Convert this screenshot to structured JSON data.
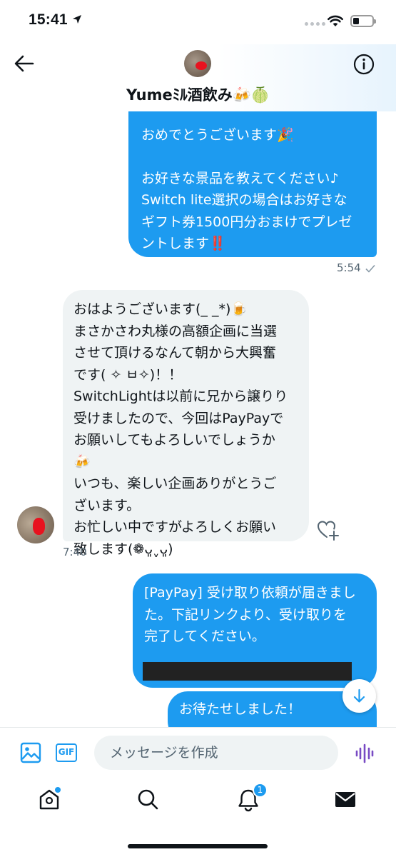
{
  "status_bar": {
    "time": "15:41"
  },
  "header": {
    "contact_name": "Yumeﾐﾙ酒飲み🍻🍈"
  },
  "messages": [
    {
      "direction": "sent",
      "lines": [
        "おめでとうございます🎉",
        "",
        "お好きな景品を教えてください♪",
        "Switch lite選択の場合はお好きな",
        "ギフト券1500円分おまけでプレゼ",
        "ントします‼️"
      ],
      "time": "5:54"
    },
    {
      "direction": "received",
      "lines": [
        "おはようございます(_ _*)🍺",
        "まさかさわ丸様の高額企画に当選",
        "させて頂けるなんて朝から大興奮",
        "です( ✧ ㅂ✧)！！",
        "SwitchLightは以前に兄から譲りり",
        "受けましたので、今回はPayPayで",
        "お願いしてもよろしいでしょうか",
        "🍻",
        "いつも、楽しい企画ありがとうご",
        "ざいます。",
        "お忙しい中ですがよろしくお願い",
        "致します(❁ᴗ͈ˬᴗ͈)"
      ],
      "time": "7:40"
    },
    {
      "direction": "sent",
      "lines": [
        "[PayPay] 受け取り依頼が届きまし",
        "た。下記リンクより、受け取りを",
        "完了してください。"
      ]
    },
    {
      "direction": "sent",
      "lines": [
        "お待たせしました！"
      ]
    }
  ],
  "composer": {
    "placeholder": "メッセージを作成",
    "gif_label": "GIF"
  },
  "tabs": {
    "notifications_badge": "1"
  },
  "colors": {
    "accent": "#1d9bf0",
    "received_bubble": "#eff3f4",
    "voice": "#794bc4"
  }
}
